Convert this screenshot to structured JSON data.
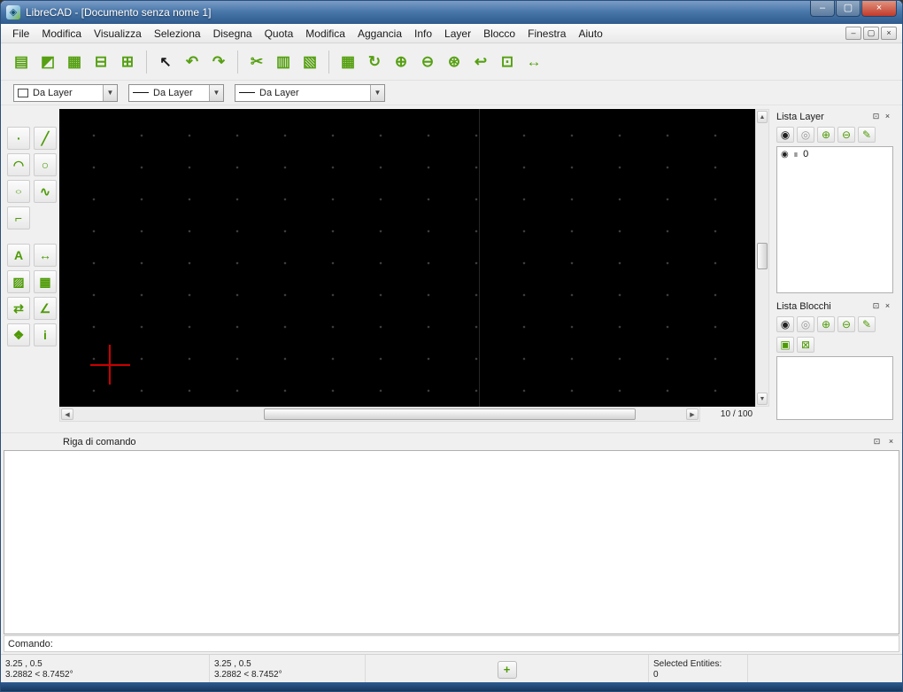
{
  "window": {
    "title": "LibreCAD - [Documento senza nome 1]"
  },
  "menu": {
    "items": [
      "File",
      "Modifica",
      "Visualizza",
      "Seleziona",
      "Disegna",
      "Quota",
      "Modifica",
      "Aggancia",
      "Info",
      "Layer",
      "Blocco",
      "Finestra",
      "Aiuto"
    ]
  },
  "combos": [
    {
      "value": "Da Layer"
    },
    {
      "value": "Da Layer"
    },
    {
      "value": "Da Layer"
    }
  ],
  "canvas": {
    "zoom_label": "10 / 100"
  },
  "layer_dock": {
    "title": "Lista Layer",
    "layers": [
      {
        "name": "0"
      }
    ]
  },
  "block_dock": {
    "title": "Lista Blocchi"
  },
  "command_dock": {
    "title": "Riga di comando",
    "history": "",
    "prompt": "Comando:"
  },
  "statusbar": {
    "abs": {
      "coords": "3.25 , 0.5",
      "polar": "3.2882 < 8.7452°"
    },
    "rel": {
      "coords": "3.25 , 0.5",
      "polar": "3.2882 < 8.7452°"
    },
    "selected": {
      "label": "Selected Entities:",
      "count": "0"
    }
  },
  "colors": {
    "accent_green": "#76b82a",
    "titlebar_blue": "#4a78ab",
    "canvas_black": "#000000",
    "crosshair_red": "#cc0000"
  },
  "icons": {
    "app": "◈",
    "minimize": "–",
    "maximize": "▢",
    "close": "×",
    "mdi_minimize": "–",
    "mdi_restore": "▢",
    "mdi_close": "×",
    "new": "▤",
    "open": "◩",
    "save": "▦",
    "print": "⊟",
    "print_preview": "⊞",
    "select": "↖",
    "undo": "↶",
    "redo": "↷",
    "cut": "✂",
    "copy": "▥",
    "paste": "▧",
    "grid": "▦",
    "redraw": "↻",
    "zoom_in": "⊕",
    "zoom_out": "⊖",
    "zoom_auto": "⊛",
    "zoom_previous": "↩",
    "zoom_window": "⊡",
    "zoom_pan": "↔",
    "point_tool": "∙",
    "line_tool": "╱",
    "arc_tool": "◠",
    "circle_tool": "○",
    "ellipse_tool": "○",
    "spline_tool": "∿",
    "polyline_tool": "⌐",
    "text_tool": "A",
    "dimension_tool": "↔",
    "hatch_tool": "▨",
    "image_tool": "▦",
    "modify_tool": "⇄",
    "measure_tool": "∠",
    "block_tool": "❖",
    "info_tool": "i",
    "eye": "◉",
    "eye_off": "◎",
    "add": "⊕",
    "remove": "⊖",
    "edit": "✎",
    "lock": "∎",
    "create_block": "▣",
    "insert_block": "⊠",
    "float_dock": "⊡",
    "dock_close": "×",
    "snap": "+",
    "up": "▲",
    "down": "▼",
    "left": "◀",
    "right": "▶"
  }
}
